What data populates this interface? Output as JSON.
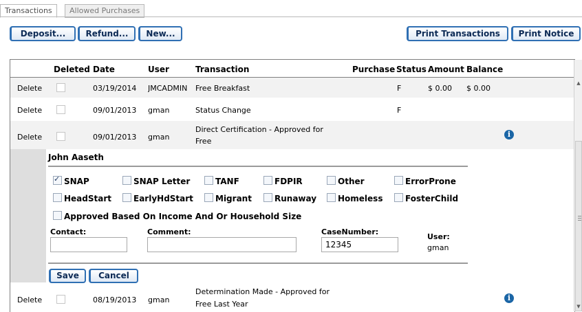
{
  "tabs": {
    "transactions": "Transactions",
    "allowed_purchases": "Allowed Purchases"
  },
  "toolbar": {
    "deposit": "Deposit...",
    "refund": "Refund...",
    "new": "New...",
    "print_transactions": "Print Transactions",
    "print_notice": "Print Notice"
  },
  "grid": {
    "headers": {
      "deleted": "Deleted",
      "date": "Date",
      "user": "User",
      "transaction": "Transaction",
      "purchase": "Purchase",
      "status": "Status",
      "amount": "Amount",
      "balance": "Balance"
    },
    "rows": [
      {
        "action": "Delete",
        "date": "03/19/2014",
        "user": "JMCADMIN",
        "transaction": "Free Breakfast",
        "status": "F",
        "amount": "$ 0.00",
        "balance": "$ 0.00"
      },
      {
        "action": "Delete",
        "date": "09/01/2013",
        "user": "gman",
        "transaction": "Status Change",
        "status": "F",
        "amount": "",
        "balance": ""
      },
      {
        "action": "Delete",
        "date": "09/01/2013",
        "user": "gman",
        "transaction_line1": "Direct Certification - Approved for",
        "transaction_line2": "Free",
        "status": "",
        "amount": "",
        "balance": ""
      },
      {
        "action": "Delete",
        "date": "08/19/2013",
        "user": "gman",
        "transaction_line1": "Determination Made - Approved for",
        "transaction_line2": "Free Last Year",
        "status": "",
        "amount": "",
        "balance": ""
      }
    ]
  },
  "detail": {
    "name": "John Aaseth",
    "programs": {
      "snap": {
        "label": "SNAP",
        "checked": true
      },
      "snap_letter": {
        "label": "SNAP Letter",
        "checked": false
      },
      "tanf": {
        "label": "TANF",
        "checked": false
      },
      "fdpir": {
        "label": "FDPIR",
        "checked": false
      },
      "other": {
        "label": "Other",
        "checked": false
      },
      "error_prone": {
        "label": "ErrorProne",
        "checked": false
      },
      "headstart": {
        "label": "HeadStart",
        "checked": false
      },
      "early_hd_start": {
        "label": "EarlyHdStart",
        "checked": false
      },
      "migrant": {
        "label": "Migrant",
        "checked": false
      },
      "runaway": {
        "label": "Runaway",
        "checked": false
      },
      "homeless": {
        "label": "Homeless",
        "checked": false
      },
      "foster_child": {
        "label": "FosterChild",
        "checked": false
      },
      "income_household": {
        "label": "Approved Based On Income And Or Household Size",
        "checked": false
      }
    },
    "contact_label": "Contact:",
    "contact_value": "",
    "comment_label": "Comment:",
    "comment_value": "",
    "case_number_label": "CaseNumber:",
    "case_number_value": "12345",
    "user_label": "User:",
    "user_value": "gman",
    "save": "Save",
    "cancel": "Cancel"
  },
  "icons": {
    "info": "info-icon"
  },
  "colors": {
    "button_border": "#2f6fb3",
    "info_icon": "#1b66a6",
    "alt_row": "#f2f2f2"
  }
}
